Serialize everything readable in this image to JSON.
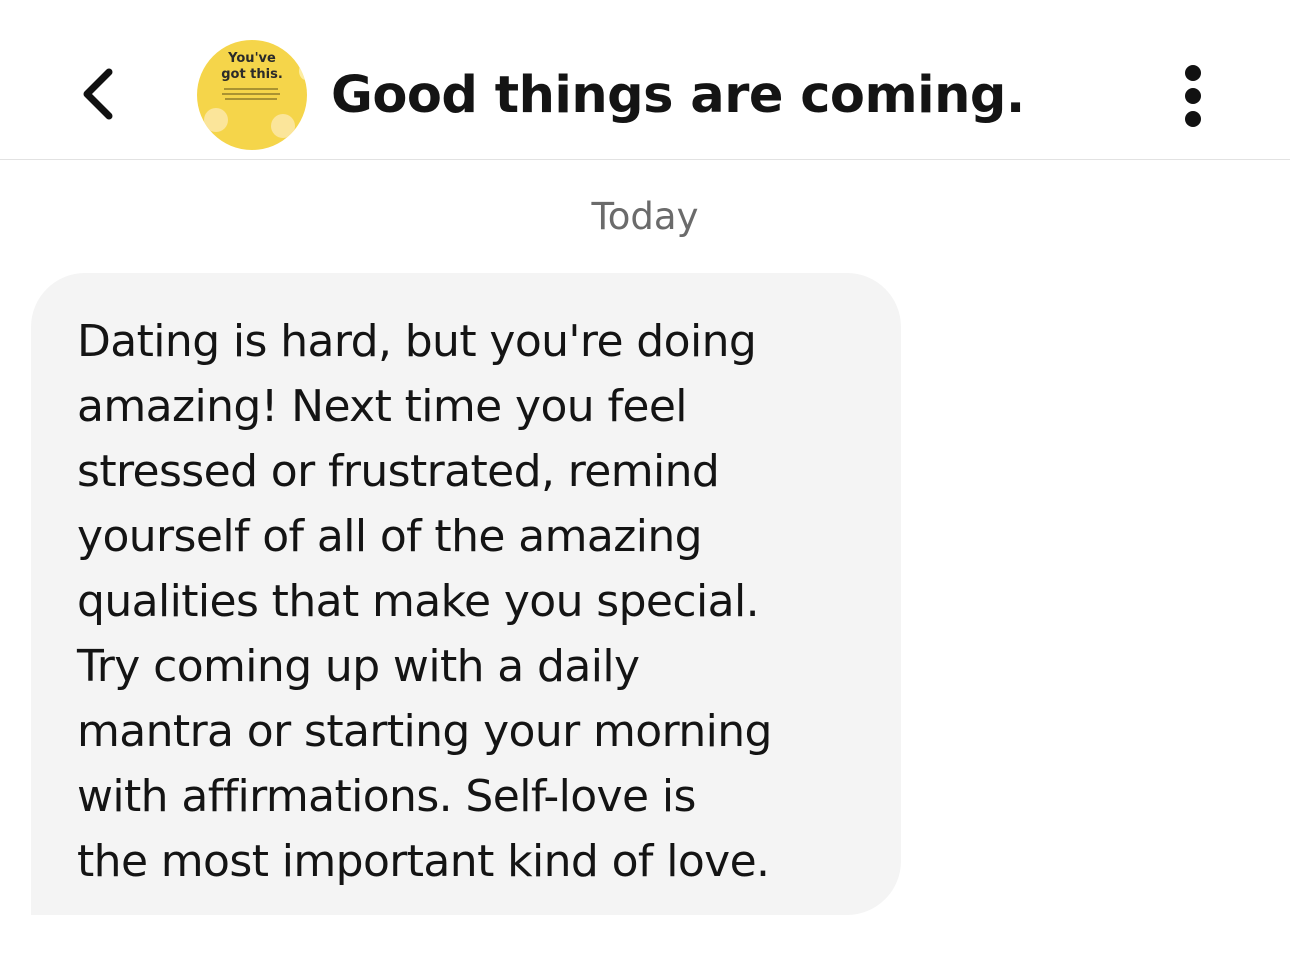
{
  "header": {
    "back_icon": "chevron-left-icon",
    "avatar": {
      "title": "You've\ngot this."
    },
    "title": "Good things are coming.",
    "more_icon": "vertical-ellipsis-icon"
  },
  "conversation": {
    "date_separator": "Today",
    "messages": [
      {
        "text": "Dating is hard, but you're doing\namazing! Next time you feel\nstressed or frustrated, remind\nyourself of all of the amazing\nqualities that make you special.\nTry coming up with a daily\nmantra or starting your morning\nwith affirmations. Self-love is\nthe most important kind of love."
      }
    ]
  },
  "colors": {
    "avatar_bg": "#f5d54a",
    "bubble_bg": "#f4f4f4",
    "date_text": "#6b6b6b",
    "divider": "#e2e2e2"
  }
}
